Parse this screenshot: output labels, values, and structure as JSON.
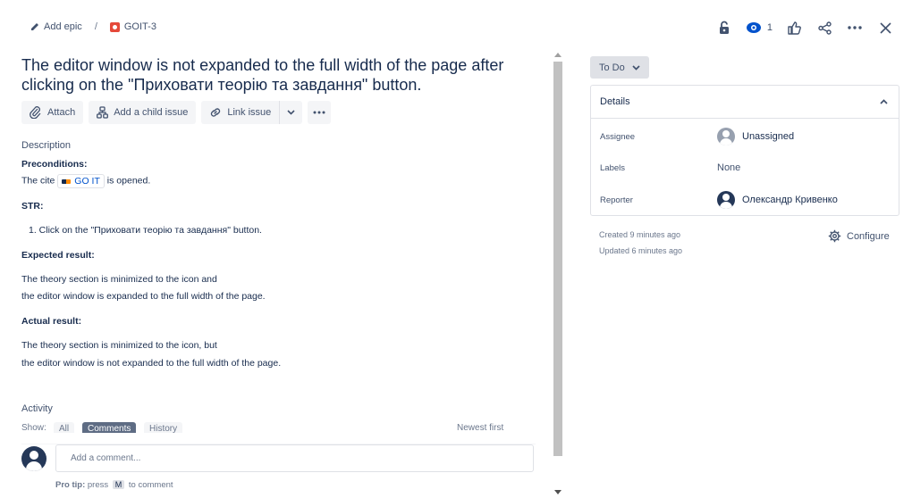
{
  "breadcrumb": {
    "epic_label": "Add epic",
    "separator": "/",
    "issue_key": "GOIT-3"
  },
  "header": {
    "watchers_count": "1"
  },
  "issue": {
    "title": "The editor window is not expanded to the full width of the page after clicking on the \"Приховати теорію та завдання\" button."
  },
  "toolbar": {
    "attach": "Attach",
    "add_child": "Add a child issue",
    "link_issue": "Link issue"
  },
  "description": {
    "label": "Description",
    "preconditions_heading": "Preconditions:",
    "cite_prefix": "The cite",
    "cite_link": "GO IT",
    "cite_suffix": "is opened.",
    "str_heading": "STR:",
    "step_1": "1. Click on the \"Приховати теорію та завдання\" button.",
    "expected_heading": "Expected result:",
    "expected_line_1": "The theory section is minimized to the icon and",
    "expected_line_2": "the editor window is expanded to the full width of the page.",
    "actual_heading": "Actual result:",
    "actual_line_1": "The theory section is minimized to the icon, but",
    "actual_line_2": "the editor window is not expanded to the full width of the page."
  },
  "activity": {
    "label": "Activity",
    "show_label": "Show:",
    "filters": [
      "All",
      "Comments",
      "History"
    ],
    "sort_label": "Newest first"
  },
  "comment": {
    "placeholder": "Add a comment...",
    "tip_prefix": "Pro tip:",
    "tip_press": "press",
    "tip_key": "M",
    "tip_suffix": "to comment"
  },
  "sidebar": {
    "status": "To Do",
    "details_title": "Details",
    "assignee_label": "Assignee",
    "assignee_value": "Unassigned",
    "labels_label": "Labels",
    "labels_value": "None",
    "reporter_label": "Reporter",
    "reporter_value": "Олександр Кривенко",
    "created": "Created 9 minutes ago",
    "updated": "Updated 6 minutes ago",
    "configure": "Configure"
  },
  "colors": {
    "accent": "#0052cc",
    "text": "#172b4d",
    "subtle": "#42526e",
    "bug": "#e5493a"
  }
}
